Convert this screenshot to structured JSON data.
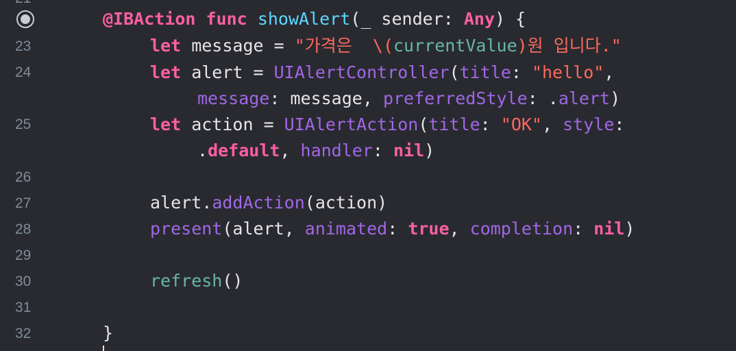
{
  "gutter": {
    "top_partial": "21",
    "line_numbers": [
      "23",
      "24",
      "25",
      "26",
      "27",
      "28",
      "29",
      "30",
      "31",
      "32"
    ]
  },
  "code": {
    "l22": [
      {
        "t": "@IBAction",
        "c": "kw"
      },
      {
        "t": " ",
        "c": "pl"
      },
      {
        "t": "func",
        "c": "kw"
      },
      {
        "t": " ",
        "c": "pl"
      },
      {
        "t": "showAlert",
        "c": "ty"
      },
      {
        "t": "(_ sender: ",
        "c": "pl"
      },
      {
        "t": "Any",
        "c": "kw"
      },
      {
        "t": ") {",
        "c": "pl"
      }
    ],
    "l23": [
      {
        "t": "let",
        "c": "kw"
      },
      {
        "t": " message = ",
        "c": "pl"
      },
      {
        "t": "\"가격은  \\(",
        "c": "st"
      },
      {
        "t": "currentValue",
        "c": "gr"
      },
      {
        "t": ")원 입니다.\"",
        "c": "st"
      }
    ],
    "l24a": [
      {
        "t": "let",
        "c": "kw"
      },
      {
        "t": " alert = ",
        "c": "pl"
      },
      {
        "t": "UIAlertController",
        "c": "fn"
      },
      {
        "t": "(",
        "c": "pl"
      },
      {
        "t": "title",
        "c": "pa"
      },
      {
        "t": ": ",
        "c": "pl"
      },
      {
        "t": "\"hello\"",
        "c": "st"
      },
      {
        "t": ",",
        "c": "pl"
      }
    ],
    "l24b": [
      {
        "t": "message",
        "c": "pa"
      },
      {
        "t": ": message, ",
        "c": "pl"
      },
      {
        "t": "preferredStyle",
        "c": "pa"
      },
      {
        "t": ": .",
        "c": "pl"
      },
      {
        "t": "alert",
        "c": "pa"
      },
      {
        "t": ")",
        "c": "pl"
      }
    ],
    "l25a": [
      {
        "t": "let",
        "c": "kw"
      },
      {
        "t": " action = ",
        "c": "pl"
      },
      {
        "t": "UIAlertAction",
        "c": "fn"
      },
      {
        "t": "(",
        "c": "pl"
      },
      {
        "t": "title",
        "c": "pa"
      },
      {
        "t": ": ",
        "c": "pl"
      },
      {
        "t": "\"OK\"",
        "c": "st"
      },
      {
        "t": ", ",
        "c": "pl"
      },
      {
        "t": "style",
        "c": "pa"
      },
      {
        "t": ":",
        "c": "pl"
      }
    ],
    "l25b": [
      {
        "t": ".",
        "c": "pl"
      },
      {
        "t": "default",
        "c": "kw"
      },
      {
        "t": ", ",
        "c": "pl"
      },
      {
        "t": "handler",
        "c": "pa"
      },
      {
        "t": ": ",
        "c": "pl"
      },
      {
        "t": "nil",
        "c": "kw"
      },
      {
        "t": ")",
        "c": "pl"
      }
    ],
    "l27": [
      {
        "t": "alert.",
        "c": "pl"
      },
      {
        "t": "addAction",
        "c": "fn"
      },
      {
        "t": "(action)",
        "c": "pl"
      }
    ],
    "l28": [
      {
        "t": "present",
        "c": "fn"
      },
      {
        "t": "(alert, ",
        "c": "pl"
      },
      {
        "t": "animated",
        "c": "pa"
      },
      {
        "t": ": ",
        "c": "pl"
      },
      {
        "t": "true",
        "c": "kw"
      },
      {
        "t": ", ",
        "c": "pl"
      },
      {
        "t": "completion",
        "c": "pa"
      },
      {
        "t": ": ",
        "c": "pl"
      },
      {
        "t": "nil",
        "c": "kw"
      },
      {
        "t": ")",
        "c": "pl"
      }
    ],
    "l30": [
      {
        "t": "refresh",
        "c": "gr"
      },
      {
        "t": "()",
        "c": "pl"
      }
    ],
    "l32": [
      {
        "t": "}",
        "c": "pl"
      }
    ]
  },
  "colors": {
    "background": "#292a30",
    "keyword": "#fc5fa3",
    "type": "#5dd8ff",
    "function": "#a167e6",
    "string": "#fc6a5d",
    "project": "#67b7a4",
    "plain": "#e6e6e8",
    "line_number": "#7f8c98"
  }
}
